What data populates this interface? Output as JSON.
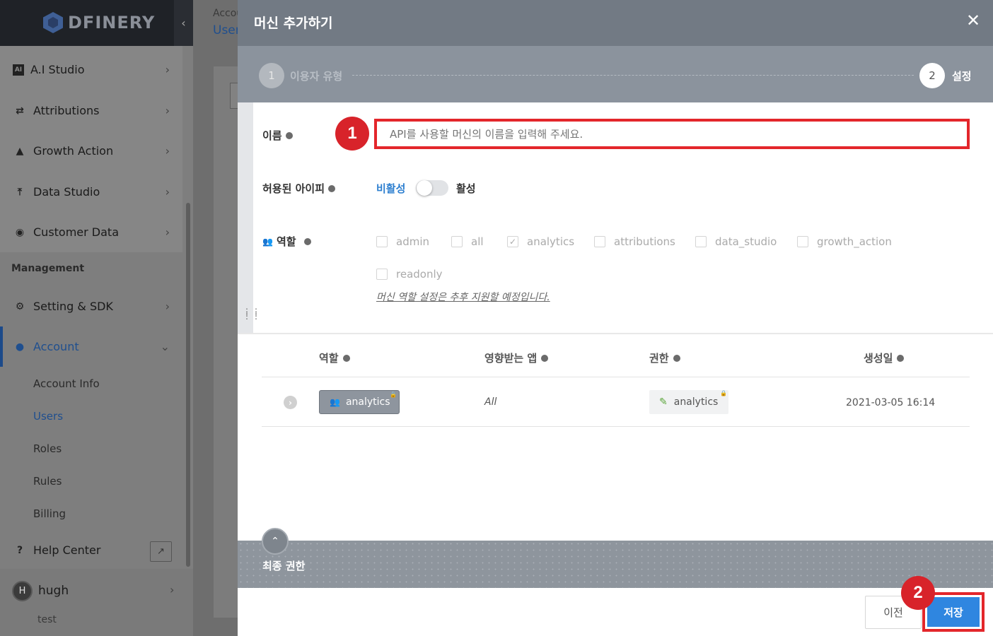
{
  "sidebar": {
    "logo_text": "DFINERY",
    "collapse_icon": "‹",
    "nav_items": [
      {
        "label": "A.I Studio",
        "icon": "ai-studio-icon"
      },
      {
        "label": "Attributions",
        "icon": "attributions-icon"
      },
      {
        "label": "Growth Action",
        "icon": "growth-action-icon"
      },
      {
        "label": "Data Studio",
        "icon": "data-studio-icon"
      },
      {
        "label": "Customer Data",
        "icon": "customer-data-icon"
      }
    ],
    "section_management": "Management",
    "setting_label": "Setting & SDK",
    "account_label": "Account",
    "account_sub": [
      "Account Info",
      "Users",
      "Roles",
      "Rules",
      "Billing"
    ],
    "help_label": "Help Center",
    "user_initial": "H",
    "user_name": "hugh",
    "user_org": "test"
  },
  "background": {
    "crumb_parent": "Accou",
    "crumb_current": "User"
  },
  "modal": {
    "title": "머신 추가하기",
    "close": "✕",
    "steps": [
      {
        "num": "1",
        "label": "이용자 유형"
      },
      {
        "num": "2",
        "label": "설정"
      }
    ],
    "name_label": "이름",
    "name_placeholder": "API를 사용할 머신의 이름을 입력해 주세요.",
    "ip_label": "허용된 아이피",
    "toggle_off": "비활성",
    "toggle_on": "활성",
    "role_label": "역할",
    "roles": [
      {
        "name": "admin",
        "checked": false
      },
      {
        "name": "all",
        "checked": false
      },
      {
        "name": "analytics",
        "checked": true
      },
      {
        "name": "attributions",
        "checked": false
      },
      {
        "name": "data_studio",
        "checked": false
      },
      {
        "name": "growth_action",
        "checked": false
      },
      {
        "name": "readonly",
        "checked": false
      }
    ],
    "role_note": "머신 역할 설정은 추후 지원할 예정입니다.",
    "table": {
      "headers": [
        "역할",
        "영향받는 앱",
        "권한",
        "생성일"
      ],
      "row": {
        "role": "analytics",
        "affected_app": "All",
        "permission": "analytics",
        "created": "2021-03-05 16:14"
      }
    },
    "final_label": "최종 권한",
    "prev_button": "이전",
    "save_button": "저장",
    "annotation_1": "1",
    "annotation_2": "2"
  },
  "colors": {
    "accent": "#2f86e0",
    "highlight": "#e3262b",
    "header": "#727a84"
  }
}
